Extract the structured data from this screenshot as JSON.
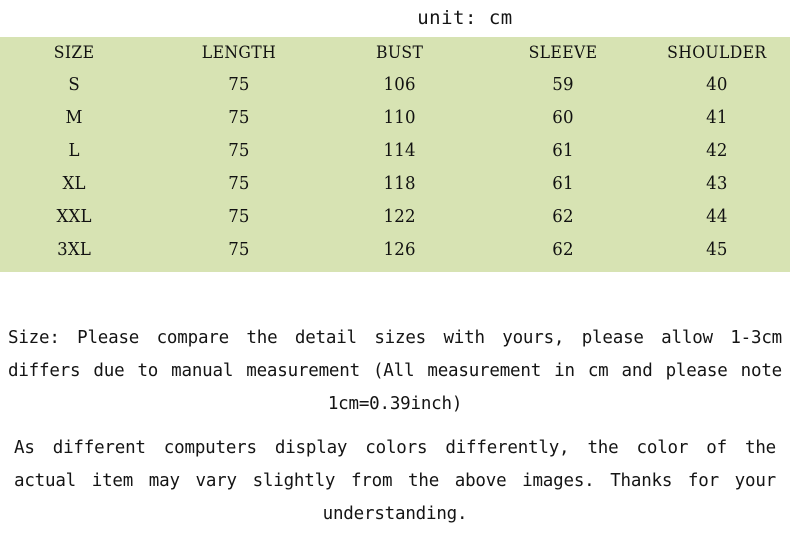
{
  "unit_label": "unit: cm",
  "table": {
    "headers": [
      "SIZE",
      "LENGTH",
      "BUST",
      "SLEEVE",
      "SHOULDER"
    ],
    "rows": [
      {
        "size": "S",
        "length": "75",
        "bust": "106",
        "sleeve": "59",
        "shoulder": "40"
      },
      {
        "size": "M",
        "length": "75",
        "bust": "110",
        "sleeve": "60",
        "shoulder": "41"
      },
      {
        "size": "L",
        "length": "75",
        "bust": "114",
        "sleeve": "61",
        "shoulder": "42"
      },
      {
        "size": "XL",
        "length": "75",
        "bust": "118",
        "sleeve": "61",
        "shoulder": "43"
      },
      {
        "size": "XXL",
        "length": "75",
        "bust": "122",
        "sleeve": "62",
        "shoulder": "44"
      },
      {
        "size": "3XL",
        "length": "75",
        "bust": "126",
        "sleeve": "62",
        "shoulder": "45"
      }
    ],
    "background_color": "#d7e3b3",
    "text_color": "#111111"
  },
  "notes": {
    "size_note": "Size: Please compare the detail sizes with yours, please allow 1-3cm differs due to manual measurement (All measurement in cm and please note 1cm=0.39inch)",
    "color_note": "As different computers display colors differently, the color of the actual item may vary slightly from the above images. Thanks for your understanding."
  }
}
